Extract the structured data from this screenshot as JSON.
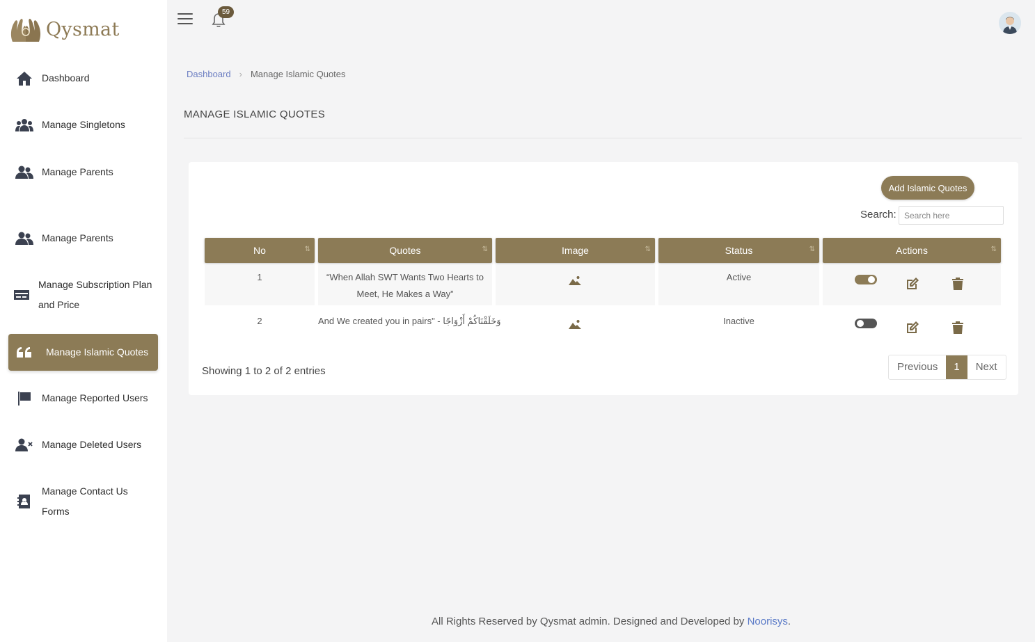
{
  "brand": {
    "name": "Qysmat",
    "accent": "#8c7b56"
  },
  "sidebar": {
    "items": [
      {
        "label": "Dashboard",
        "icon": "home-icon"
      },
      {
        "label": "Manage Singletons",
        "icon": "users-icon"
      },
      {
        "label": "Manage Parents",
        "icon": "user-group-icon"
      },
      {
        "label": "Manage Parents",
        "icon": "user-group-icon"
      },
      {
        "label": "Manage Subscription Plan and Price",
        "icon": "card-icon"
      },
      {
        "label": "Manage Islamic Quotes",
        "icon": "quote-icon",
        "active": true
      },
      {
        "label": "Manage Reported Users",
        "icon": "flag-icon"
      },
      {
        "label": "Manage Deleted Users",
        "icon": "user-x-icon"
      },
      {
        "label": "Manage Contact Us Forms",
        "icon": "contact-book-icon"
      }
    ]
  },
  "topbar": {
    "notification_count": "59",
    "menu_icon": "hamburger-icon",
    "bell_icon": "bell-icon"
  },
  "breadcrumb": {
    "home": "Dashboard",
    "current": "Manage Islamic Quotes"
  },
  "page": {
    "title": "MANAGE ISLAMIC QUOTES"
  },
  "toolbar": {
    "add_label": "Add Islamic Quotes",
    "search_label": "Search:",
    "search_placeholder": "Search here"
  },
  "table": {
    "columns": [
      "No",
      "Quotes",
      "Image",
      "Status",
      "Actions"
    ],
    "rows": [
      {
        "no": "1",
        "quote": "“When Allah SWT Wants Two Hearts to Meet, He Makes a Way”",
        "status": "Active",
        "enabled": true
      },
      {
        "no": "2",
        "quote": "And We created you in pairs\" - وَخَلَقْنَاكُمْ أَزْوَاجًا",
        "status": "Inactive",
        "enabled": false
      }
    ]
  },
  "pagination": {
    "info": "Showing 1 to 2 of 2 entries",
    "previous": "Previous",
    "current": "1",
    "next": "Next"
  },
  "footer": {
    "text": "All Rights Reserved by Qysmat admin. Designed and Developed by",
    "link": "Noorisys",
    "end": "."
  }
}
